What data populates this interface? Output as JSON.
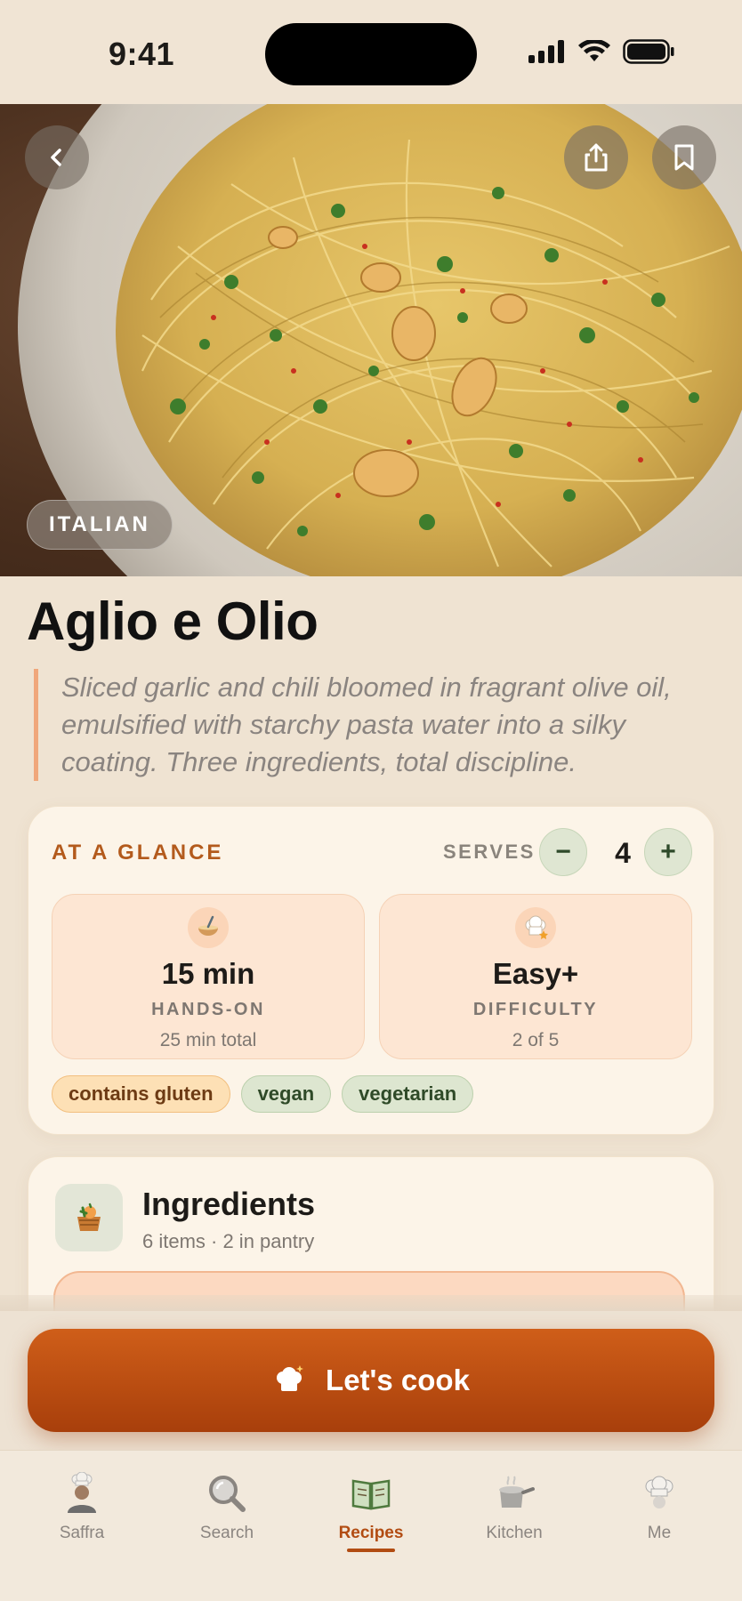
{
  "status_bar": {
    "time": "9:41"
  },
  "hero": {
    "back_icon": "chevron-left-icon",
    "share_icon": "share-icon",
    "bookmark_icon": "bookmark-icon",
    "cuisine": "ITALIAN"
  },
  "recipe": {
    "title": "Aglio e Olio",
    "description": "Sliced garlic and chili bloomed in fragrant olive oil, emulsified with starchy pasta water into a silky coating. Three ingredients, total discipline."
  },
  "glance": {
    "label": "AT A GLANCE",
    "serves_label": "SERVES",
    "serves_value": "4",
    "minus": "−",
    "plus": "+",
    "time": {
      "main": "15 min",
      "sub": "HANDS-ON",
      "foot": "25 min total",
      "icon": "whisk-bowl-icon"
    },
    "difficulty": {
      "main": "Easy+",
      "sub": "DIFFICULTY",
      "foot": "2 of 5",
      "icon": "chef-hat-icon"
    },
    "tags": [
      "contains gluten",
      "vegan",
      "vegetarian"
    ]
  },
  "ingredients": {
    "title": "Ingredients",
    "meta": "6 items · 2 in pantry",
    "icon": "basket-icon"
  },
  "cta": {
    "label": "Let's cook",
    "icon": "chef-hat-icon"
  },
  "tabs": [
    {
      "label": "Saffra",
      "icon": "chef-avatar-icon"
    },
    {
      "label": "Search",
      "icon": "search-icon"
    },
    {
      "label": "Recipes",
      "icon": "book-icon",
      "active": true
    },
    {
      "label": "Kitchen",
      "icon": "pot-icon"
    },
    {
      "label": "Me",
      "icon": "chef-hat-icon"
    }
  ],
  "colors": {
    "accent": "#b24c12",
    "cta_top": "#cf5e19",
    "cta_bottom": "#a83f0b",
    "background": "#efe3d2"
  }
}
